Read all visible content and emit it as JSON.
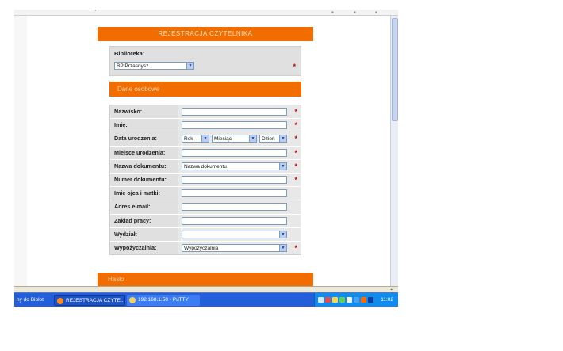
{
  "form": {
    "header": "REJESTRACJA CZYTELNIKA",
    "library_label": "Biblioteka:",
    "library_value": "BP Przasnysz",
    "required_marker": "*",
    "section_personal": "Dane osobowe",
    "section_password": "Hasło",
    "fields": [
      {
        "label": "Nazwisko:",
        "type": "text",
        "required": true
      },
      {
        "label": "Imię:",
        "type": "text",
        "required": true
      },
      {
        "label": "Data urodzenia:",
        "type": "date",
        "year": "Rok",
        "month": "Miesiąc",
        "day": "Dzień",
        "required": true
      },
      {
        "label": "Miejsce urodzenia:",
        "type": "text",
        "required": true
      },
      {
        "label": "Nazwa dokumentu:",
        "type": "select",
        "value": "Nazwa dokumentu",
        "required": true
      },
      {
        "label": "Numer dokumentu:",
        "type": "text",
        "required": true
      },
      {
        "label": "Imię ojca i matki:",
        "type": "text",
        "required": false
      },
      {
        "label": "Adres e-mail:",
        "type": "text",
        "required": false
      },
      {
        "label": "Zakład pracy:",
        "type": "text",
        "required": false
      },
      {
        "label": "Wydział:",
        "type": "select",
        "value": "",
        "required": false
      },
      {
        "label": "Wypożyczalnia:",
        "type": "select",
        "value": "Wypożyczalnia",
        "required": true
      }
    ]
  },
  "taskbar": {
    "items": [
      {
        "label": "ny do Biblot",
        "icon": "app-icon"
      },
      {
        "label": "REJESTRACJA CZYTE...",
        "icon": "browser-icon"
      },
      {
        "label": "192.168.1.50 - PuTTY",
        "icon": "putty-icon"
      }
    ],
    "clock": "11:02"
  },
  "colors": {
    "accent": "#f26d00",
    "panel": "#e0e0e0",
    "taskbar": "#245edb"
  }
}
